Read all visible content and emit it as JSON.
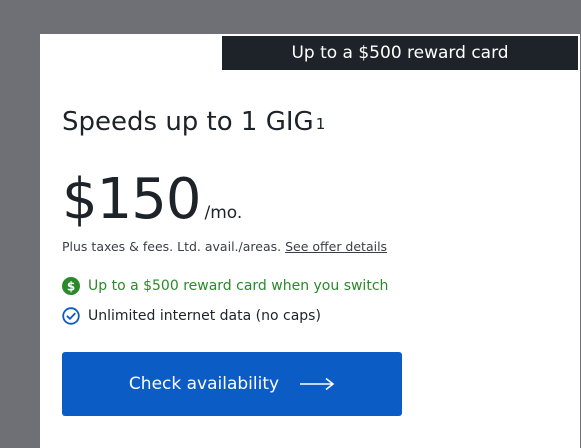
{
  "card": {
    "banner_text": "Up to a $500 reward card",
    "title": "Speeds up to 1 GIG",
    "title_footnote": "1",
    "price": "$150",
    "price_unit": "/mo.",
    "fine_print": "Plus taxes & fees. Ltd. avail./areas.",
    "offer_link": "See offer details",
    "features": [
      {
        "icon": "dollar-circle-icon",
        "text": "Up to a $500 reward card when you switch",
        "color": "#2a8a2a"
      },
      {
        "icon": "check-circle-icon",
        "text": "Unlimited internet data (no caps)",
        "color": "#0b5cc4"
      }
    ],
    "cta_label": "Check availability",
    "cta_icon": "arrow-right-icon",
    "cta_color": "#0b5cc4"
  }
}
